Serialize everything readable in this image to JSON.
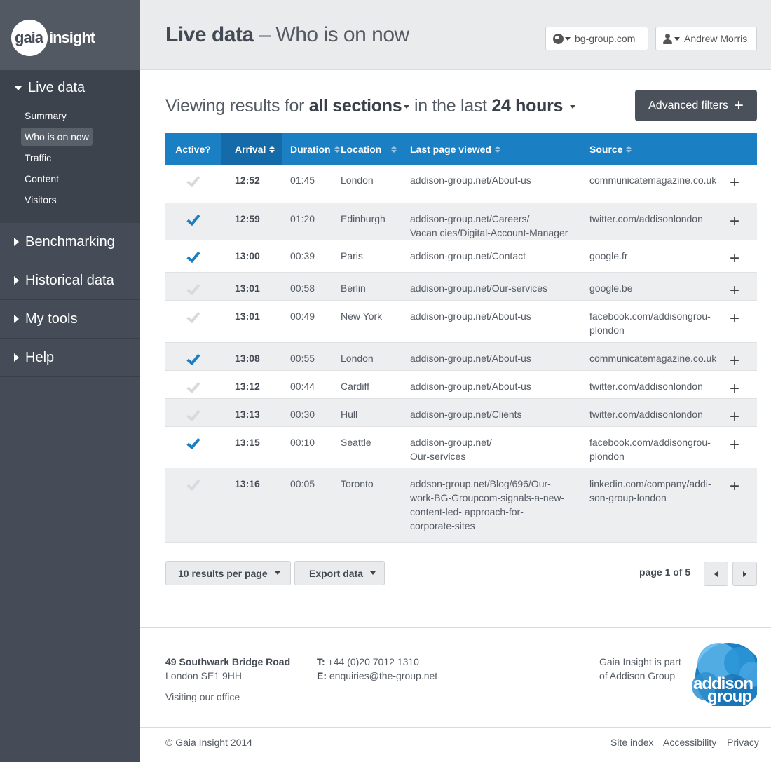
{
  "brand": {
    "gaia": "gaia",
    "insight": "insight"
  },
  "sidebar": {
    "open_section": "Live data",
    "sub_items": [
      "Summary",
      "Who is on now",
      "Traffic",
      "Content",
      "Visitors"
    ],
    "active_sub": "Who is on now",
    "sections": [
      "Benchmarking",
      "Historical data",
      "My tools",
      "Help"
    ]
  },
  "header": {
    "title_bold": "Live data",
    "title_rest": " – Who is on now",
    "site_selector": "bg-group.com",
    "user_menu": "Andrew Morris"
  },
  "filters": {
    "prefix": "Viewing results for ",
    "section_value": "all sections",
    "middle": " in the last ",
    "period_value": "24 hours",
    "advanced_button": "Advanced filters"
  },
  "table": {
    "headers": [
      "Active?",
      "Arrival",
      "Duration",
      "Location",
      "Last page viewed",
      "Source"
    ],
    "rows": [
      {
        "active": false,
        "arrival": "12:52",
        "duration": "01:45",
        "location": "London",
        "page": [
          "addison-group.net/About-us"
        ],
        "source": [
          "communicatemagazine.co.uk"
        ]
      },
      {
        "active": true,
        "arrival": "12:59",
        "duration": "01:20",
        "location": "Edinburgh",
        "page": [
          "addison-group.net/Careers/",
          "Vacan cies/Digital-Account-Manager"
        ],
        "source": [
          "twitter.com/addisonlondon"
        ]
      },
      {
        "active": true,
        "arrival": "13:00",
        "duration": "00:39",
        "location": "Paris",
        "page": [
          "addison-group.net/Contact"
        ],
        "source": [
          "google.fr"
        ]
      },
      {
        "active": false,
        "arrival": "13:01",
        "duration": "00:58",
        "location": "Berlin",
        "page": [
          "addison-group.net/Our-services"
        ],
        "source": [
          "google.be"
        ]
      },
      {
        "active": false,
        "arrival": "13:01",
        "duration": "00:49",
        "location": "New York",
        "page": [
          "addison-group.net/About-us"
        ],
        "source": [
          "facebook.com/addisongrou-",
          "plondon"
        ]
      },
      {
        "active": true,
        "arrival": "13:08",
        "duration": "00:55",
        "location": "London",
        "page": [
          "addison-group.net/About-us"
        ],
        "source": [
          "communicatemagazine.co.uk"
        ]
      },
      {
        "active": false,
        "arrival": "13:12",
        "duration": "00:44",
        "location": "Cardiff",
        "page": [
          "addison-group.net/About-us"
        ],
        "source": [
          "twitter.com/addisonlondon"
        ]
      },
      {
        "active": false,
        "arrival": "13:13",
        "duration": "00:30",
        "location": "Hull",
        "page": [
          "addison-group.net/Clients"
        ],
        "source": [
          "twitter.com/addisonlondon"
        ]
      },
      {
        "active": true,
        "arrival": "13:15",
        "duration": "00:10",
        "location": "Seattle",
        "page": [
          "addison-group.net/",
          "Our-services"
        ],
        "source": [
          "facebook.com/addisongrou-",
          "plondon"
        ]
      },
      {
        "active": false,
        "arrival": "13:16",
        "duration": "00:05",
        "location": "Toronto",
        "page": [
          "addson-group.net/Blog/696/Our-",
          "work-BG-Groupcom-signals-a-new-",
          "content-led- approach-for-",
          "corporate-sites"
        ],
        "source": [
          "linkedin.com/company/addi-",
          "son-group-london"
        ]
      }
    ],
    "expand_symbol": "+"
  },
  "controls": {
    "per_page": "10 results per page",
    "export": "Export data",
    "pager": "page 1 of 5"
  },
  "footer": {
    "address_line1": "49 Southwark Bridge Road",
    "address_line2": "London SE1 9HH",
    "visit": "Visiting our office",
    "tel_label": "T:",
    "tel": " +44 (0)20 7012 1310",
    "email_label": "E:",
    "email": " enquiries@the-group.net",
    "part_of_1": "Gaia Insight is part",
    "part_of_2": "of Addison Group",
    "partner_logo_text": [
      "addison",
      "group"
    ],
    "copyright": "© Gaia Insight 2014",
    "links": [
      "Site index",
      "Accessibility",
      "Privacy"
    ]
  },
  "colors": {
    "accent": "#1b7fc4",
    "sidebar": "#464c57",
    "header_bg": "#eaebed"
  }
}
